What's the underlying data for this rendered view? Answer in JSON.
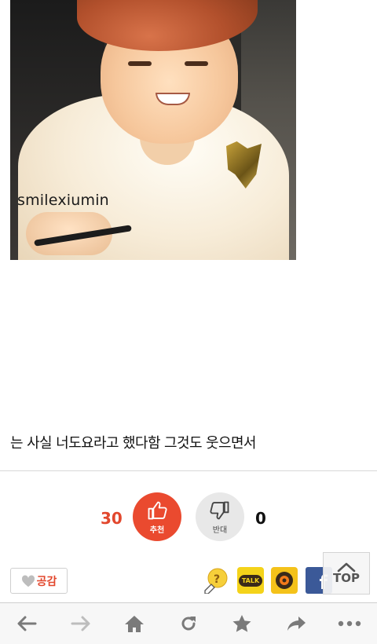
{
  "photo": {
    "watermark": "smilexiumin"
  },
  "post": {
    "caption": "는 사실 너도요라고 했다함 그것도 웃으면서"
  },
  "vote": {
    "up_count": "30",
    "up_label": "추천",
    "down_label": "반대",
    "down_count": "0",
    "up_color": "#ea4a2f",
    "down_color": "#e8e8e8"
  },
  "share": {
    "like_label": "공감",
    "kakaotalk_label": "TALK",
    "facebook_label": "f"
  },
  "top_button": {
    "label": "TOP"
  },
  "browser_nav": {
    "items": [
      "back-icon",
      "forward-icon",
      "home-icon",
      "refresh-icon",
      "bookmark-star-icon",
      "share-arrow-icon",
      "more-icon"
    ]
  },
  "colors": {
    "accent": "#e2472d",
    "nav_icon": "#7a7a7a"
  }
}
